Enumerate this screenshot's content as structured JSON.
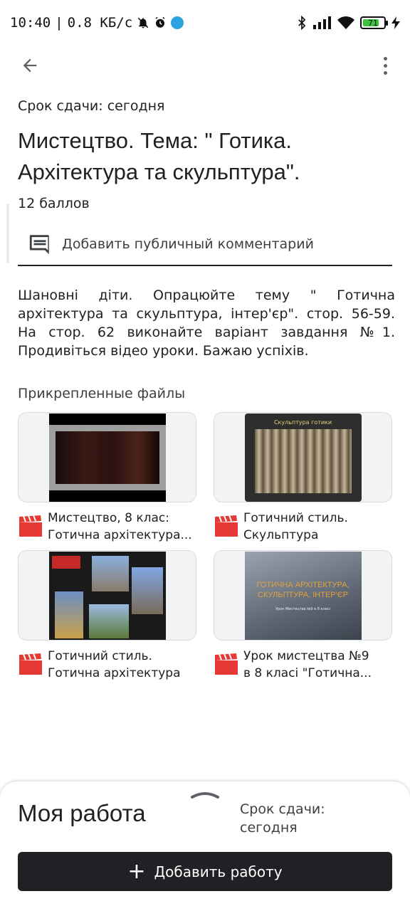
{
  "status_bar": {
    "time": "10:40",
    "speed": "0.8 КБ/с",
    "battery": "71"
  },
  "assignment": {
    "due": "Срок сдачи: сегодня",
    "title": "Мистецтво. Тема: \" Готика. Архітектура та скульптура\".",
    "points": "12 баллов",
    "comment_label": "Добавить публичный комментарий",
    "description": "Шановні діти. Опрацюйте тему \" Готична архітектура та скульптура, інтер'єр\". стор. 56-59. На стор. 62 виконайте варіант завдання №1. Продивіться відео уроки. Бажаю успіхів."
  },
  "files": {
    "header": "Прикрепленные файлы",
    "items": [
      {
        "line1": "Мистецтво, 8 клас:",
        "line2": "Готична архітектура..."
      },
      {
        "line1": "Готичний стиль.",
        "line2": "Скульптура"
      },
      {
        "line1": "Готичний стиль.",
        "line2": "Готична архітектура"
      },
      {
        "line1": "Урок мистецтва №9",
        "line2": "в 8 класі \"Готична..."
      }
    ],
    "thumb2_caption": "Скульптура готики",
    "thumb4_caption": "ГОТИЧНА АРХІТЕКТУРА, СКУЛЬПТУРА, ІНТЕР'ЄР",
    "thumb4_sub": "Урок Мистецтва №9 в 8 класі"
  },
  "my_work": {
    "title": "Моя работа",
    "due": "Срок сдачи: сегодня",
    "add_label": "Добавить работу"
  },
  "colors": {
    "accent_dark": "#202124",
    "clapper_red": "#e53935",
    "battery_green": "#3ec23e"
  }
}
